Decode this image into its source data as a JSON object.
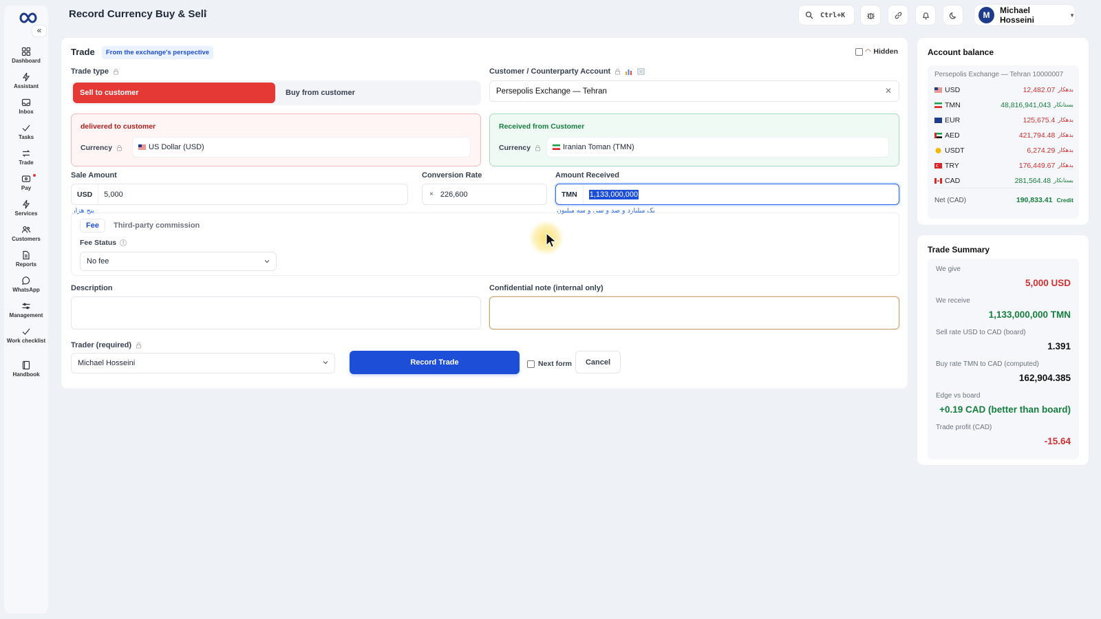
{
  "header": {
    "title": "Record Currency Buy & Sell",
    "search_shortcut": "Ctrl+K",
    "user_initial": "M",
    "user_name": "Michael Hosseini"
  },
  "sidebar": {
    "items": [
      {
        "label": "Dashboard",
        "icon": "dashboard-icon"
      },
      {
        "label": "Assistant",
        "icon": "bolt-icon"
      },
      {
        "label": "Inbox",
        "icon": "inbox-icon"
      },
      {
        "label": "Tasks",
        "icon": "check-icon"
      },
      {
        "label": "Trade",
        "icon": "swap-icon"
      },
      {
        "label": "Pay",
        "icon": "wallet-icon"
      },
      {
        "label": "Services",
        "icon": "bolt-icon"
      },
      {
        "label": "Customers",
        "icon": "users-icon"
      },
      {
        "label": "Reports",
        "icon": "file-icon"
      },
      {
        "label": "WhatsApp",
        "icon": "chat-icon"
      },
      {
        "label": "Management",
        "icon": "sliders-icon"
      },
      {
        "label": "Work checklist",
        "icon": "check-icon"
      },
      {
        "label": "Handbook",
        "icon": "book-icon"
      }
    ]
  },
  "trade": {
    "title": "Trade",
    "perspective_badge": "From the exchange's perspective",
    "hidden_label": "Hidden",
    "hidden_checked": false,
    "trade_type_label": "Trade type",
    "sell_label": "Sell to customer",
    "buy_label": "Buy from customer",
    "account_label": "Customer / Counterparty Account",
    "account_value": "Persepolis Exchange — Tehran",
    "deliver_title": "delivered to customer",
    "receive_title": "Received from Customer",
    "currency_label": "Currency",
    "deliver_currency": "US Dollar (USD)",
    "receive_currency": "Iranian Toman (TMN)",
    "sale_amount_label": "Sale Amount",
    "sale_currency": "USD",
    "sale_amount": "5,000",
    "sale_amount_words": "پنج هزار",
    "rate_label": "Conversion Rate",
    "rate_op": "×",
    "rate_value": "226,600",
    "received_label": "Amount Received",
    "received_currency": "TMN",
    "received_amount": "1,133,000,000",
    "received_words": "یک میلیارد و صد و سی و سه میلیون",
    "fee_tab": "Fee",
    "commission_tab": "Third-party commission",
    "fee_status_label": "Fee Status",
    "fee_status_value": "No fee",
    "description_label": "Description",
    "confidential_label": "Confidential note (internal only)",
    "trader_label": "Trader (required)",
    "trader_value": "Michael Hosseini",
    "record_button": "Record Trade",
    "next_form_label": "Next form",
    "next_form_checked": false,
    "cancel_button": "Cancel"
  },
  "balance": {
    "title": "Account balance",
    "account": "Persepolis Exchange — Tehran 10000007",
    "rows": [
      {
        "code": "USD",
        "value": "12,482.07",
        "tag": "بدهکار",
        "status": "debit",
        "flag": "us"
      },
      {
        "code": "TMN",
        "value": "48,816,941,043",
        "tag": "بستانکار",
        "status": "credit",
        "flag": "ir"
      },
      {
        "code": "EUR",
        "value": "125,675.4",
        "tag": "بدهکار",
        "status": "debit",
        "flag": "eu"
      },
      {
        "code": "AED",
        "value": "421,794.48",
        "tag": "بدهکار",
        "status": "debit",
        "flag": "ae"
      },
      {
        "code": "USDT",
        "value": "6,274.29",
        "tag": "بدهکار",
        "status": "debit",
        "flag": "usdt"
      },
      {
        "code": "TRY",
        "value": "176,449.67",
        "tag": "بدهکار",
        "status": "debit",
        "flag": "tr"
      },
      {
        "code": "CAD",
        "value": "281,564.48",
        "tag": "بستانکار",
        "status": "credit",
        "flag": "ca"
      }
    ],
    "net_label": "Net (CAD)",
    "net_value": "190,833.41",
    "net_tag": "Credit"
  },
  "summary": {
    "title": "Trade Summary",
    "give_label": "We give",
    "give_value": "5,000 USD",
    "receive_label": "We receive",
    "receive_value": "1,133,000,000 TMN",
    "sell_rate_label": "Sell rate USD to CAD (board)",
    "sell_rate_value": "1.391",
    "buy_rate_label": "Buy rate TMN to CAD (computed)",
    "buy_rate_value": "162,904.385",
    "edge_label": "Edge vs board",
    "edge_value": "+0.19 CAD (better than board)",
    "profit_label": "Trade profit (CAD)",
    "profit_value": "-15.64"
  },
  "colors": {
    "accent": "#1d4ed8",
    "sell": "#e53935",
    "debit": "#d32f2f",
    "credit": "#15803d"
  }
}
